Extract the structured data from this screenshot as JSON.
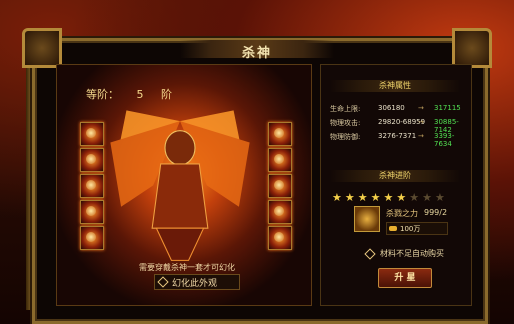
{
  "window": {
    "title": "杀神"
  },
  "left": {
    "rank_label": "等阶：",
    "rank_value": "5",
    "rank_unit": "阶",
    "need_text": "需要穿戴杀神一套才可幻化",
    "illusion_label": "幻化此外观"
  },
  "attributes": {
    "header": "杀神属性",
    "rows": [
      {
        "label": "生命上限:",
        "current": "306180",
        "next": "317115"
      },
      {
        "label": "物理攻击:",
        "current": "29820-68959",
        "next": "30885-7142"
      },
      {
        "label": "物理防御:",
        "current": "3276-7371",
        "next": "3393-7634"
      }
    ]
  },
  "advance": {
    "header": "杀神进阶",
    "stars_filled": 6,
    "stars_total": 9,
    "item_name": "杀戮之力",
    "item_count": "999/2",
    "gold": "100万",
    "auto_buy_label": "材料不足自动购买",
    "upgrade_label": "升 星"
  },
  "colors": {
    "next_value": "#52e052",
    "gold": "#f2d66c"
  }
}
